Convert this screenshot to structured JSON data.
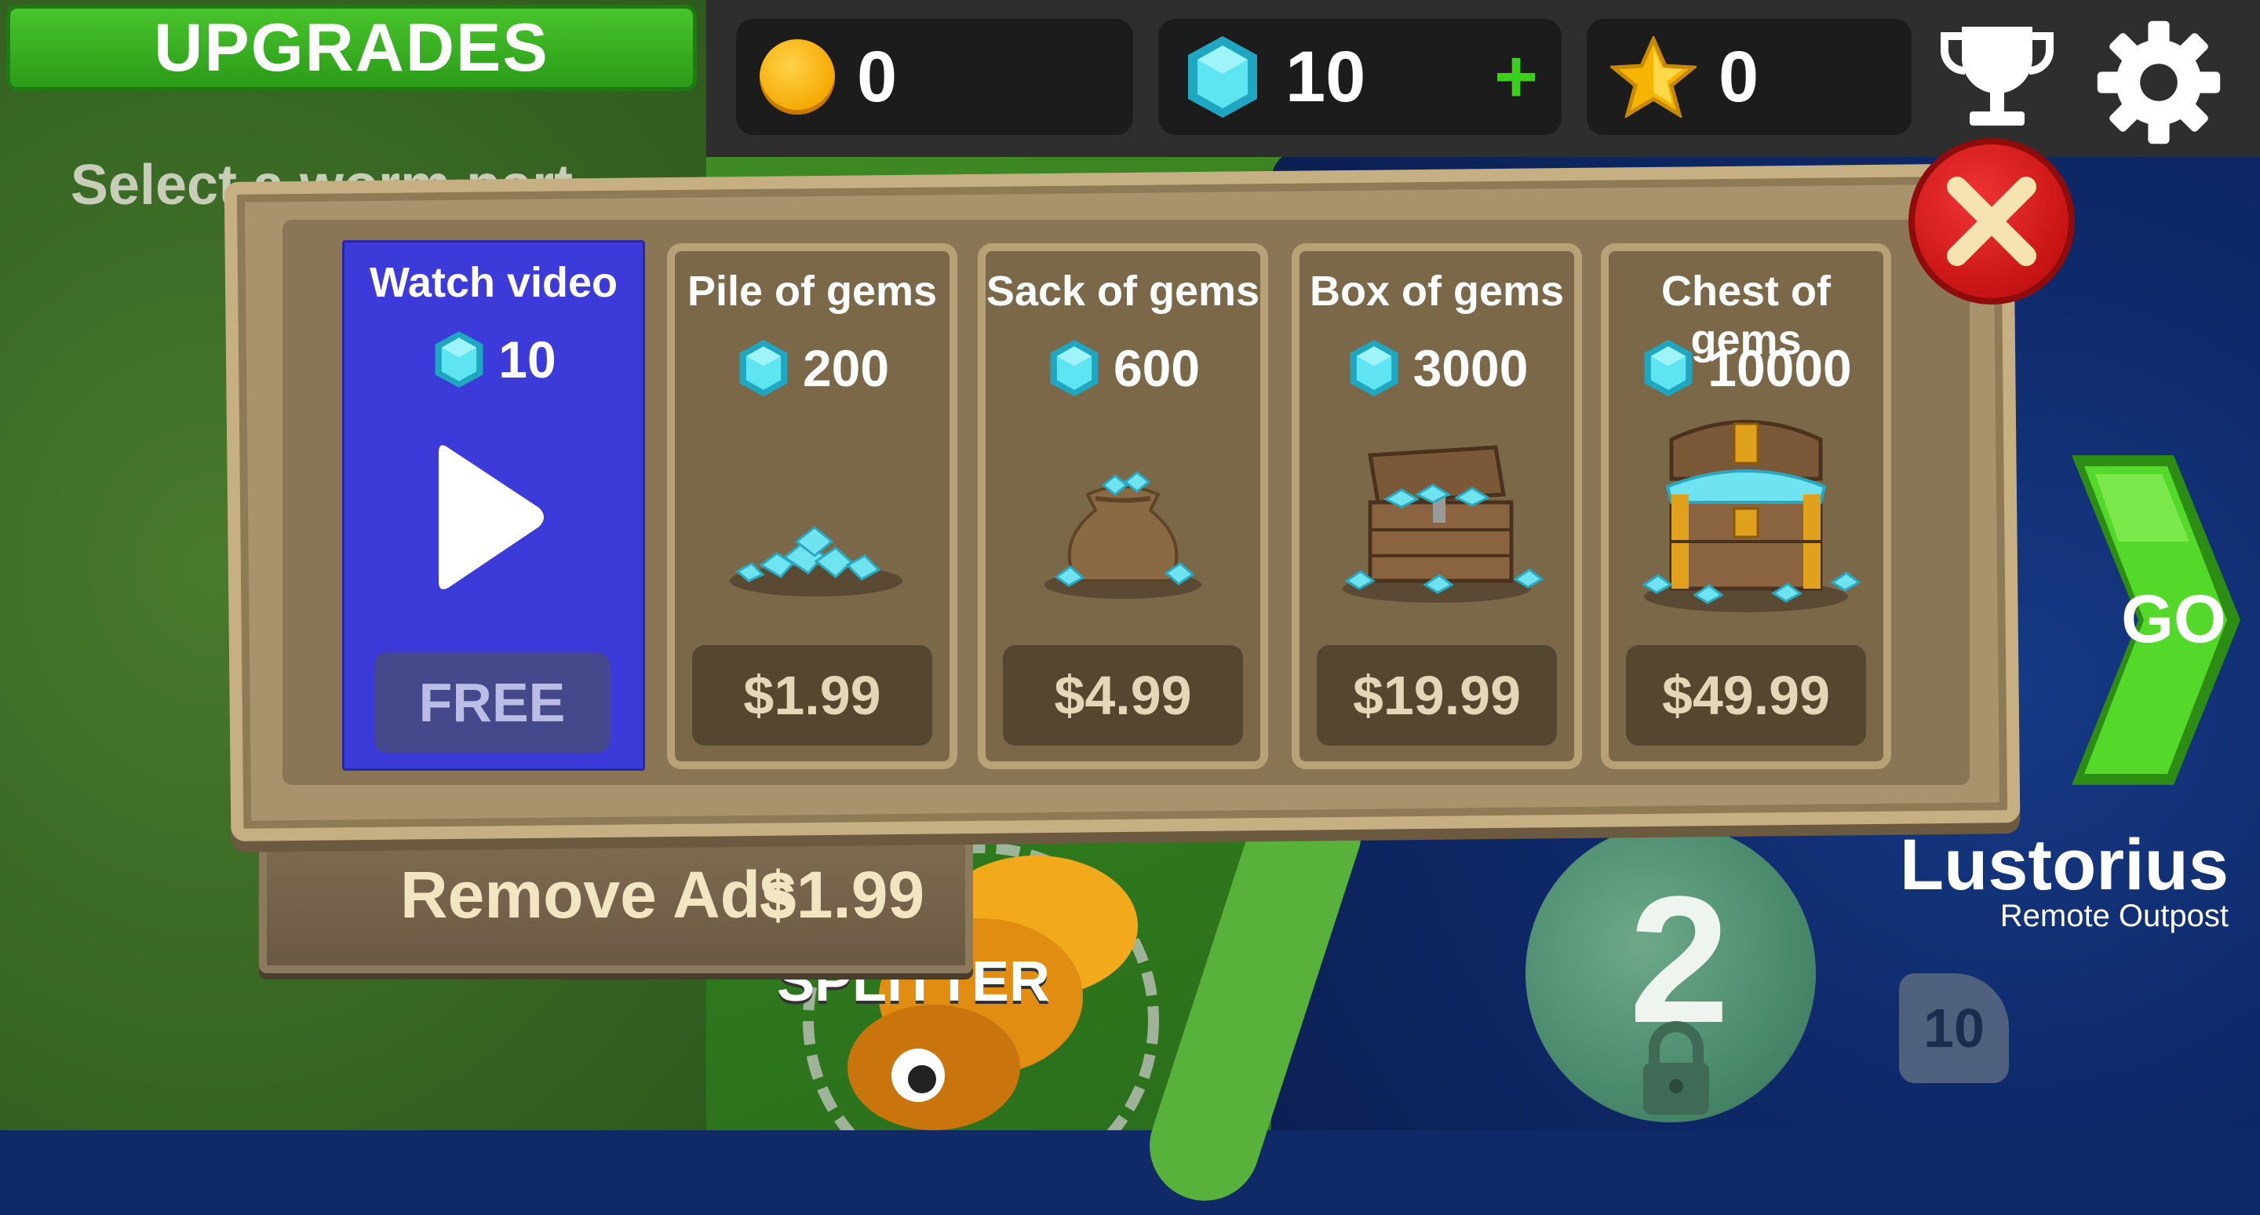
{
  "header": {
    "title": "UPGRADES",
    "subtitle_line1": "Select a worm part"
  },
  "topbar": {
    "coins": "0",
    "gems": "10",
    "stars": "0",
    "icons": [
      "coin-icon",
      "gem-icon",
      "plus-icon",
      "star-icon",
      "trophy-icon",
      "gear-icon"
    ]
  },
  "shop": {
    "cards": [
      {
        "id": "video",
        "title": "Watch video",
        "amount": "10",
        "price": "FREE"
      },
      {
        "id": "pile",
        "title": "Pile of gems",
        "amount": "200",
        "price": "$1.99"
      },
      {
        "id": "sack",
        "title": "Sack of gems",
        "amount": "600",
        "price": "$4.99"
      },
      {
        "id": "box",
        "title": "Box of gems",
        "amount": "3000",
        "price": "$19.99"
      },
      {
        "id": "chest",
        "title": "Chest of gems",
        "amount": "10000",
        "price": "$49.99"
      }
    ],
    "remove_ads": {
      "label": "Remove Ads",
      "price": "$1.99"
    }
  },
  "map": {
    "location_name": "Lustorius",
    "location_sub": "Remote Outpost",
    "planet_number": "2",
    "badge": "10",
    "go_label": "GO",
    "worm_name": "SPLITTER"
  },
  "colors": {
    "video_card": "#3c3ad8",
    "accent_green": "#3ad11c",
    "close_red": "#d21818",
    "gem_cyan": "#4fd8e8"
  }
}
